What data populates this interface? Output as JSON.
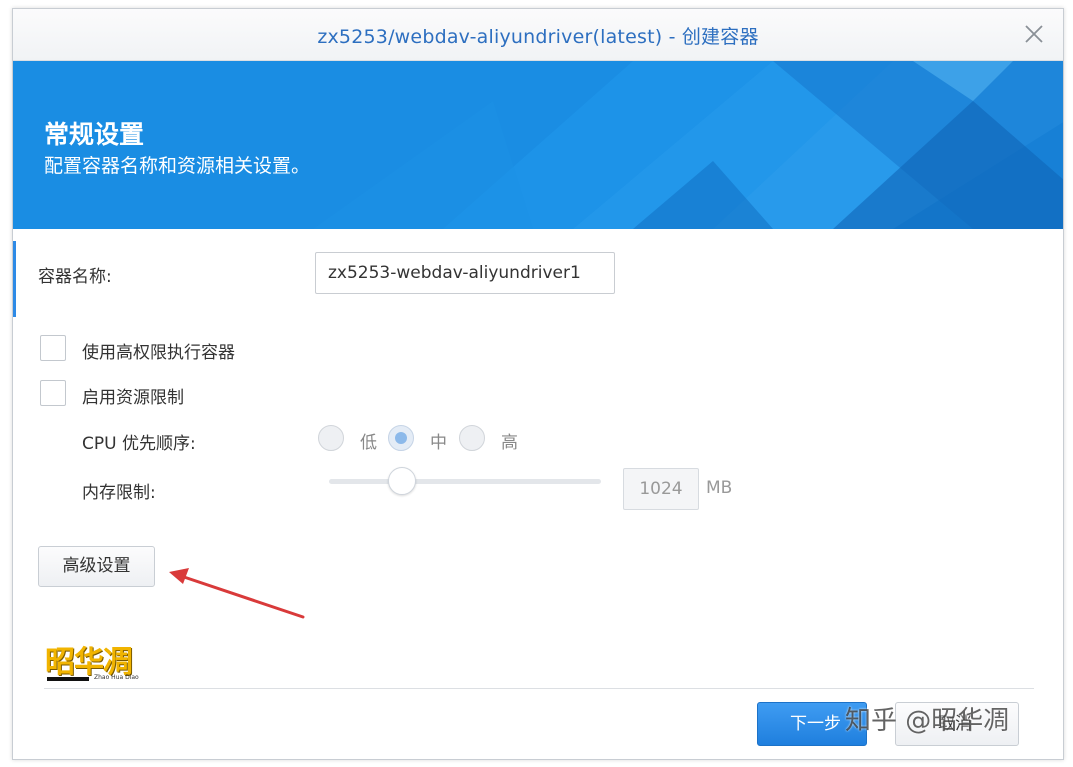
{
  "dialog": {
    "title": "zx5253/webdav-aliyundriver(latest) - 创建容器",
    "close_icon": "close-icon"
  },
  "banner": {
    "title": "常规设置",
    "subtitle": "配置容器名称和资源相关设置。"
  },
  "form": {
    "container_name_label": "容器名称:",
    "container_name_value": "zx5253-webdav-aliyundriver1",
    "privileged_label": "使用高权限执行容器",
    "privileged_checked": false,
    "resource_limit_label": "启用资源限制",
    "resource_limit_checked": false,
    "cpu_priority_label": "CPU 优先顺序:",
    "cpu_options": [
      "低",
      "中",
      "高"
    ],
    "cpu_selected": "中",
    "memory_label": "内存限制:",
    "memory_value": "1024",
    "memory_unit": "MB",
    "memory_slider_fraction": 0.27,
    "advanced_button": "高级设置"
  },
  "logo": {
    "text": "昭华凋",
    "subtext": "Zhao Hua Diao"
  },
  "footer": {
    "next_button": "下一步",
    "cancel_button": "取消"
  },
  "watermark": "知乎 @昭华凋",
  "colors": {
    "title_blue": "#2d6fc0",
    "banner_blue": "#1a8de3",
    "primary_button": "#2b8de6",
    "arrow_red": "#d93a3a"
  }
}
